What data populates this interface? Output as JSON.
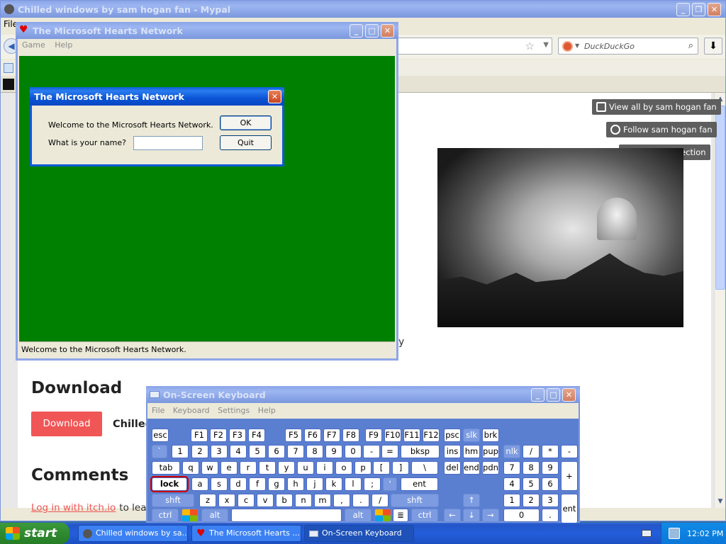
{
  "browser": {
    "title": "Chilled windows by sam hogan fan - Mypal",
    "menu_file": "File",
    "search_engine": "DuckDuckGo",
    "page": {
      "btn_view_all": "View all by sam hogan fan",
      "btn_follow": "Follow sam hogan fan",
      "btn_add_collection": "Add To Collection",
      "partial_text_y": "y",
      "heading_download": "Download",
      "download_button": "Download",
      "download_file_label": "Chilled",
      "heading_comments": "Comments",
      "login_link": "Log in with itch.io",
      "login_suffix": " to lea"
    }
  },
  "hearts": {
    "title": "The Microsoft Hearts Network",
    "menu": [
      "Game",
      "Help"
    ],
    "status": "Welcome to the Microsoft Hearts Network."
  },
  "dialog": {
    "title": "The Microsoft Hearts Network",
    "welcome": "Welcome to the Microsoft Hearts Network.",
    "name_prompt": "What is your name?",
    "name_value": "",
    "ok": "OK",
    "quit": "Quit"
  },
  "osk": {
    "title": "On-Screen Keyboard",
    "menu": [
      "File",
      "Keyboard",
      "Settings",
      "Help"
    ],
    "row1": [
      "esc",
      "F1",
      "F2",
      "F3",
      "F4",
      "F5",
      "F6",
      "F7",
      "F8",
      "F9",
      "F10",
      "F11",
      "F12",
      "psc",
      "slk",
      "brk"
    ],
    "row2": [
      "`",
      "1",
      "2",
      "3",
      "4",
      "5",
      "6",
      "7",
      "8",
      "9",
      "0",
      "-",
      "=",
      "bksp",
      "ins",
      "hm",
      "pup",
      "nlk",
      "/",
      "*",
      "-"
    ],
    "row3": [
      "tab",
      "q",
      "w",
      "e",
      "r",
      "t",
      "y",
      "u",
      "i",
      "o",
      "p",
      "[",
      "]",
      "\\",
      "del",
      "end",
      "pdn",
      "7",
      "8",
      "9",
      "+"
    ],
    "row4": [
      "lock",
      "a",
      "s",
      "d",
      "f",
      "g",
      "h",
      "j",
      "k",
      "l",
      ";",
      "'",
      "ent",
      "4",
      "5",
      "6"
    ],
    "row5": [
      "shft",
      "z",
      "x",
      "c",
      "v",
      "b",
      "n",
      "m",
      ",",
      ".",
      "/",
      "shft",
      "1",
      "2",
      "3",
      "ent"
    ],
    "row6": [
      "ctrl",
      "alt",
      "alt",
      "ctrl",
      "0",
      "."
    ]
  },
  "taskbar": {
    "start": "start",
    "tasks": [
      "Chilled windows by sa...",
      "The Microsoft Hearts ...",
      "On-Screen Keyboard"
    ],
    "clock": "12:02 PM"
  }
}
